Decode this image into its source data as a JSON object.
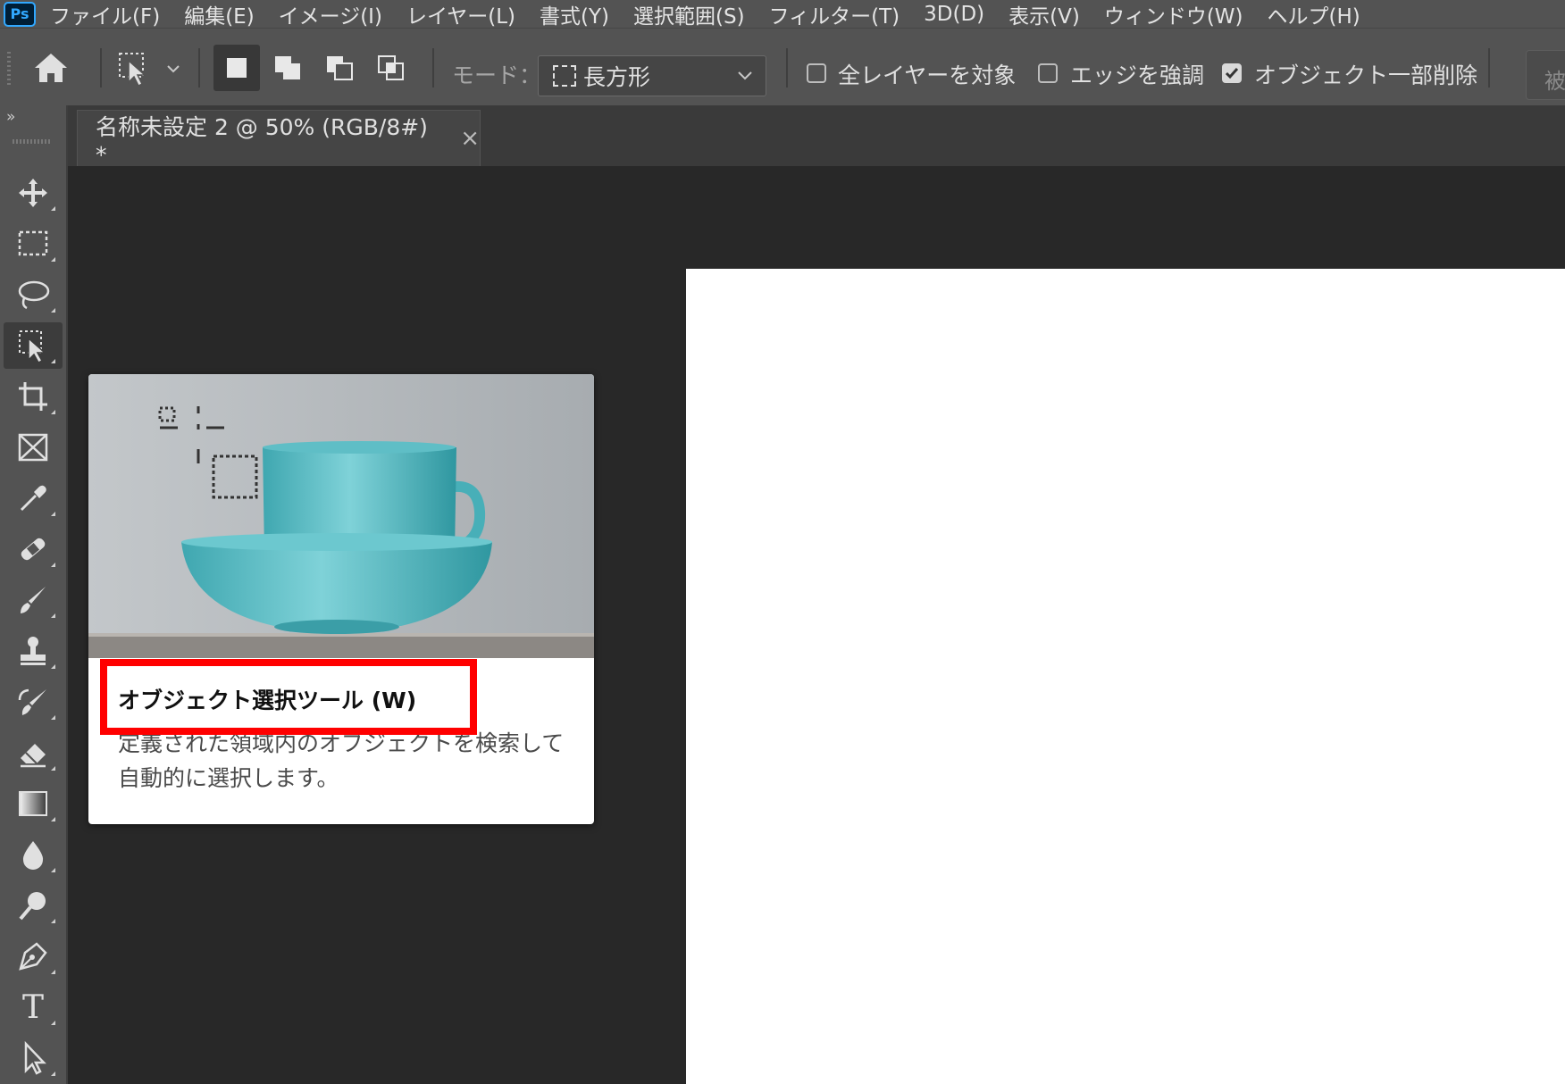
{
  "app": {
    "logo_text": "Ps",
    "accent_color": "#31a8ff"
  },
  "menu": {
    "items": [
      "ファイル(F)",
      "編集(E)",
      "イメージ(I)",
      "レイヤー(L)",
      "書式(Y)",
      "選択範囲(S)",
      "フィルター(T)",
      "3D(D)",
      "表示(V)",
      "ウィンドウ(W)",
      "ヘルプ(H)"
    ]
  },
  "options": {
    "home_icon": "home-icon",
    "tool_preset_icon": "object-selection-icon",
    "mode_label": "モード：",
    "mode_value": "長方形",
    "all_layers_label": "全レイヤーを対象",
    "all_layers_checked": false,
    "enhance_edge_label": "エッジを強調",
    "enhance_edge_checked": false,
    "object_subtract_label": "オブジェクト一部削除",
    "object_subtract_checked": true,
    "cut_button_text": "被"
  },
  "document_tab": {
    "title": "名称未設定 2 @ 50% (RGB/8#) *",
    "close_glyph": "×"
  },
  "toolbar": {
    "collapse_glyph": "»",
    "tools": [
      {
        "name": "move-tool-icon"
      },
      {
        "name": "marquee-tool-icon"
      },
      {
        "name": "lasso-tool-icon"
      },
      {
        "name": "object-selection-tool-icon",
        "active": true
      },
      {
        "name": "crop-tool-icon"
      },
      {
        "name": "frame-tool-icon"
      },
      {
        "name": "eyedropper-tool-icon"
      },
      {
        "name": "healing-brush-tool-icon"
      },
      {
        "name": "brush-tool-icon"
      },
      {
        "name": "clone-stamp-tool-icon"
      },
      {
        "name": "history-brush-tool-icon"
      },
      {
        "name": "eraser-tool-icon"
      },
      {
        "name": "gradient-tool-icon"
      },
      {
        "name": "blur-tool-icon"
      },
      {
        "name": "dodge-tool-icon"
      },
      {
        "name": "pen-tool-icon"
      },
      {
        "name": "type-tool-icon"
      },
      {
        "name": "path-selection-tool-icon"
      }
    ],
    "type_tool_glyph": "T"
  },
  "tooltip": {
    "title": "オブジェクト選択ツール (W)",
    "description": "定義された領域内のオブジェクトを検索して自動的に選択します。"
  },
  "colors": {
    "highlight": "#ff0000",
    "teal_cup": "#4fb6bf"
  }
}
